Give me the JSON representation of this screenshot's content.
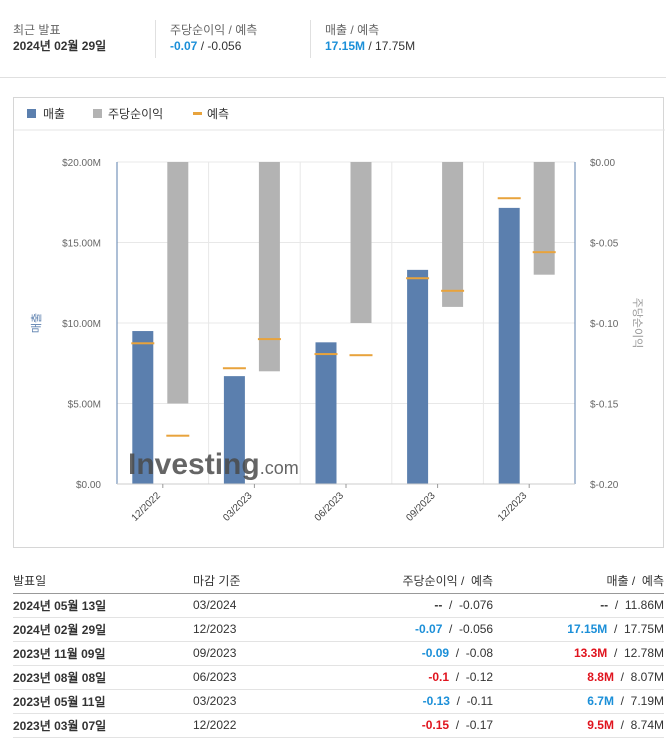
{
  "summary": {
    "latest": {
      "label": "최근 발표",
      "value": "2024년 02월 29일"
    },
    "eps": {
      "label": "주당순이익 / 예측",
      "actual": "-0.07",
      "forecast": " / -0.056"
    },
    "revenue": {
      "label": "매출 / 예측",
      "actual": "17.15M",
      "forecast": " / 17.75M"
    }
  },
  "legend": {
    "revenue": "매출",
    "eps": "주당순이익",
    "forecast": "예측"
  },
  "colors": {
    "revenue": "#5b7fae",
    "eps": "#b3b3b3",
    "forecast": "#e8a33c",
    "blue": "#1b8fd8",
    "red": "#e0141e"
  },
  "chart_data": {
    "type": "bar",
    "categories": [
      "12/2022",
      "03/2023",
      "06/2023",
      "09/2023",
      "12/2023"
    ],
    "series": [
      {
        "name": "매출",
        "axis": "left",
        "values": [
          9.5,
          6.7,
          8.8,
          13.3,
          17.15
        ],
        "forecast": [
          8.74,
          7.19,
          8.07,
          12.78,
          17.75
        ]
      },
      {
        "name": "주당순이익",
        "axis": "right",
        "values": [
          -0.15,
          -0.13,
          -0.1,
          -0.09,
          -0.07
        ],
        "forecast": [
          -0.17,
          -0.11,
          -0.12,
          -0.08,
          -0.056
        ]
      }
    ],
    "ylabel": "매출",
    "y2label": "주당순이익",
    "ylim": [
      0,
      20
    ],
    "y2lim": [
      -0.2,
      0
    ],
    "yticks": [
      "$0.00",
      "$5.00M",
      "$10.00M",
      "$15.00M",
      "$20.00M"
    ],
    "y2ticks": [
      "$-0.20",
      "$-0.15",
      "$-0.10",
      "$-0.05",
      "$0.00"
    ],
    "watermark": "Investing.com",
    "legend_position": "top-left",
    "grid": true
  },
  "table": {
    "headers": {
      "date": "발표일",
      "period": "마감 기준",
      "eps": "주당순이익",
      "eps_forecast": " /  예측",
      "revenue": "매출",
      "revenue_forecast": " /  예측"
    },
    "rows": [
      {
        "date": "2024년 05월 13일",
        "period": "03/2024",
        "eps": "--",
        "eps_color": "",
        "eps_forecast": "  /  -0.076",
        "revenue": "--",
        "revenue_color": "",
        "revenue_forecast": "  /  11.86M"
      },
      {
        "date": "2024년 02월 29일",
        "period": "12/2023",
        "eps": "-0.07",
        "eps_color": "blue",
        "eps_forecast": "  /  -0.056",
        "revenue": "17.15M",
        "revenue_color": "blue",
        "revenue_forecast": "  /  17.75M"
      },
      {
        "date": "2023년 11월 09일",
        "period": "09/2023",
        "eps": "-0.09",
        "eps_color": "blue",
        "eps_forecast": "  /  -0.08",
        "revenue": "13.3M",
        "revenue_color": "red",
        "revenue_forecast": "  /  12.78M"
      },
      {
        "date": "2023년 08월 08일",
        "period": "06/2023",
        "eps": "-0.1",
        "eps_color": "red",
        "eps_forecast": "  /  -0.12",
        "revenue": "8.8M",
        "revenue_color": "red",
        "revenue_forecast": "  /  8.07M"
      },
      {
        "date": "2023년 05월 11일",
        "period": "03/2023",
        "eps": "-0.13",
        "eps_color": "blue",
        "eps_forecast": "  /  -0.11",
        "revenue": "6.7M",
        "revenue_color": "blue",
        "revenue_forecast": "  /  7.19M"
      },
      {
        "date": "2023년 03월 07일",
        "period": "12/2022",
        "eps": "-0.15",
        "eps_color": "red",
        "eps_forecast": "  /  -0.17",
        "revenue": "9.5M",
        "revenue_color": "red",
        "revenue_forecast": "  /  8.74M"
      }
    ]
  }
}
